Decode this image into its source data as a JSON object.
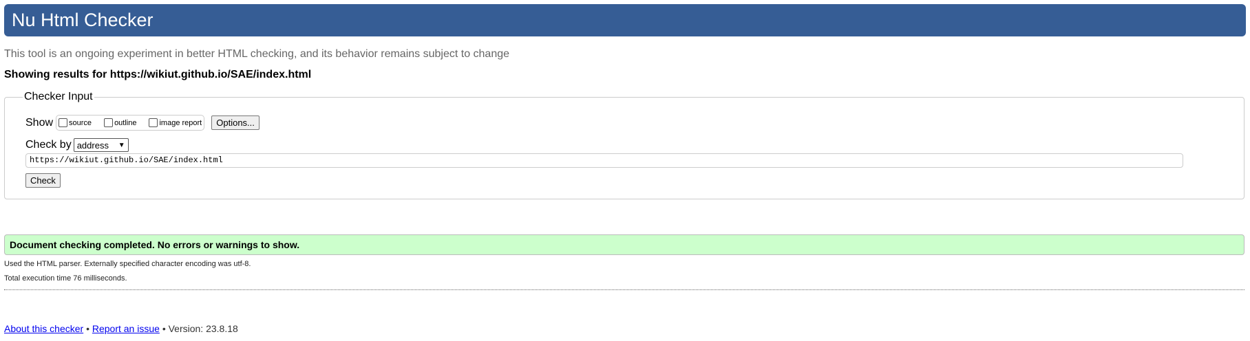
{
  "header": {
    "title": "Nu Html Checker"
  },
  "subtitle": "This tool is an ongoing experiment in better HTML checking, and its behavior remains subject to change",
  "results_for": "Showing results for https://wikiut.github.io/SAE/index.html",
  "checker_input": {
    "legend": "Checker Input",
    "show_label": "Show",
    "show_options": [
      {
        "label": "source",
        "checked": false
      },
      {
        "label": "outline",
        "checked": false
      },
      {
        "label": "image report",
        "checked": false
      }
    ],
    "options_button": "Options...",
    "check_by_label": "Check by",
    "check_by_value": "address",
    "url_value": "https://wikiut.github.io/SAE/index.html",
    "check_button": "Check"
  },
  "result": {
    "success_message": "Document checking completed. No errors or warnings to show.",
    "parser_info": "Used the HTML parser. Externally specified character encoding was utf-8.",
    "execution_time": "Total execution time 76 milliseconds."
  },
  "footer": {
    "about": "About this checker",
    "sep": "•",
    "report": "Report an issue",
    "version": "Version: 23.8.18"
  },
  "colors": {
    "header_bg": "#365d95",
    "success_bg": "#ccffcc",
    "link": "#0000ee"
  }
}
